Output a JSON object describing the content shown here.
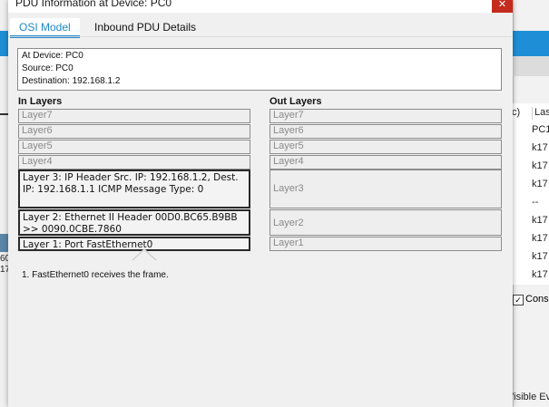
{
  "window": {
    "title": "PDU Information at Device: PC0",
    "close_glyph": "✕"
  },
  "tabs": [
    {
      "label": "OSI Model",
      "active": true
    },
    {
      "label": "Inbound PDU Details",
      "active": false
    }
  ],
  "info": {
    "device": "At Device: PC0",
    "source": "Source: PC0",
    "destination": "Destination: 192.168.1.2"
  },
  "in_layers": {
    "heading": "In Layers",
    "layer7": "Layer7",
    "layer6": "Layer6",
    "layer5": "Layer5",
    "layer4": "Layer4",
    "layer3": "Layer 3: IP Header Src. IP: 192.168.1.2, Dest. IP: 192.168.1.1 ICMP Message Type: 0",
    "layer2": "Layer 2: Ethernet II Header 00D0.BC65.B9BB >> 0090.0CBE.7860",
    "layer1": "Layer 1: Port FastEthernet0"
  },
  "out_layers": {
    "heading": "Out Layers",
    "layer7": "Layer7",
    "layer6": "Layer6",
    "layer5": "Layer5",
    "layer4": "Layer4",
    "layer3": "Layer3",
    "layer2": "Layer2",
    "layer1": "Layer1"
  },
  "description": "1. FastEthernet0 receives the frame.",
  "background": {
    "left_texts": [
      "60",
      "17"
    ],
    "header_parts": [
      "c)",
      "Las"
    ],
    "rows": [
      "PC1",
      "k17",
      "k17",
      "k17",
      "--",
      "k17",
      "k17",
      "k17",
      "k17"
    ],
    "checkbox_label": "Cons",
    "checkbox_checked": "✓",
    "bottom_text": "Visible Ev"
  },
  "colors": {
    "accent": "#1e88c8",
    "close": "#c42b1c",
    "app_blue": "#1e8fd6"
  }
}
